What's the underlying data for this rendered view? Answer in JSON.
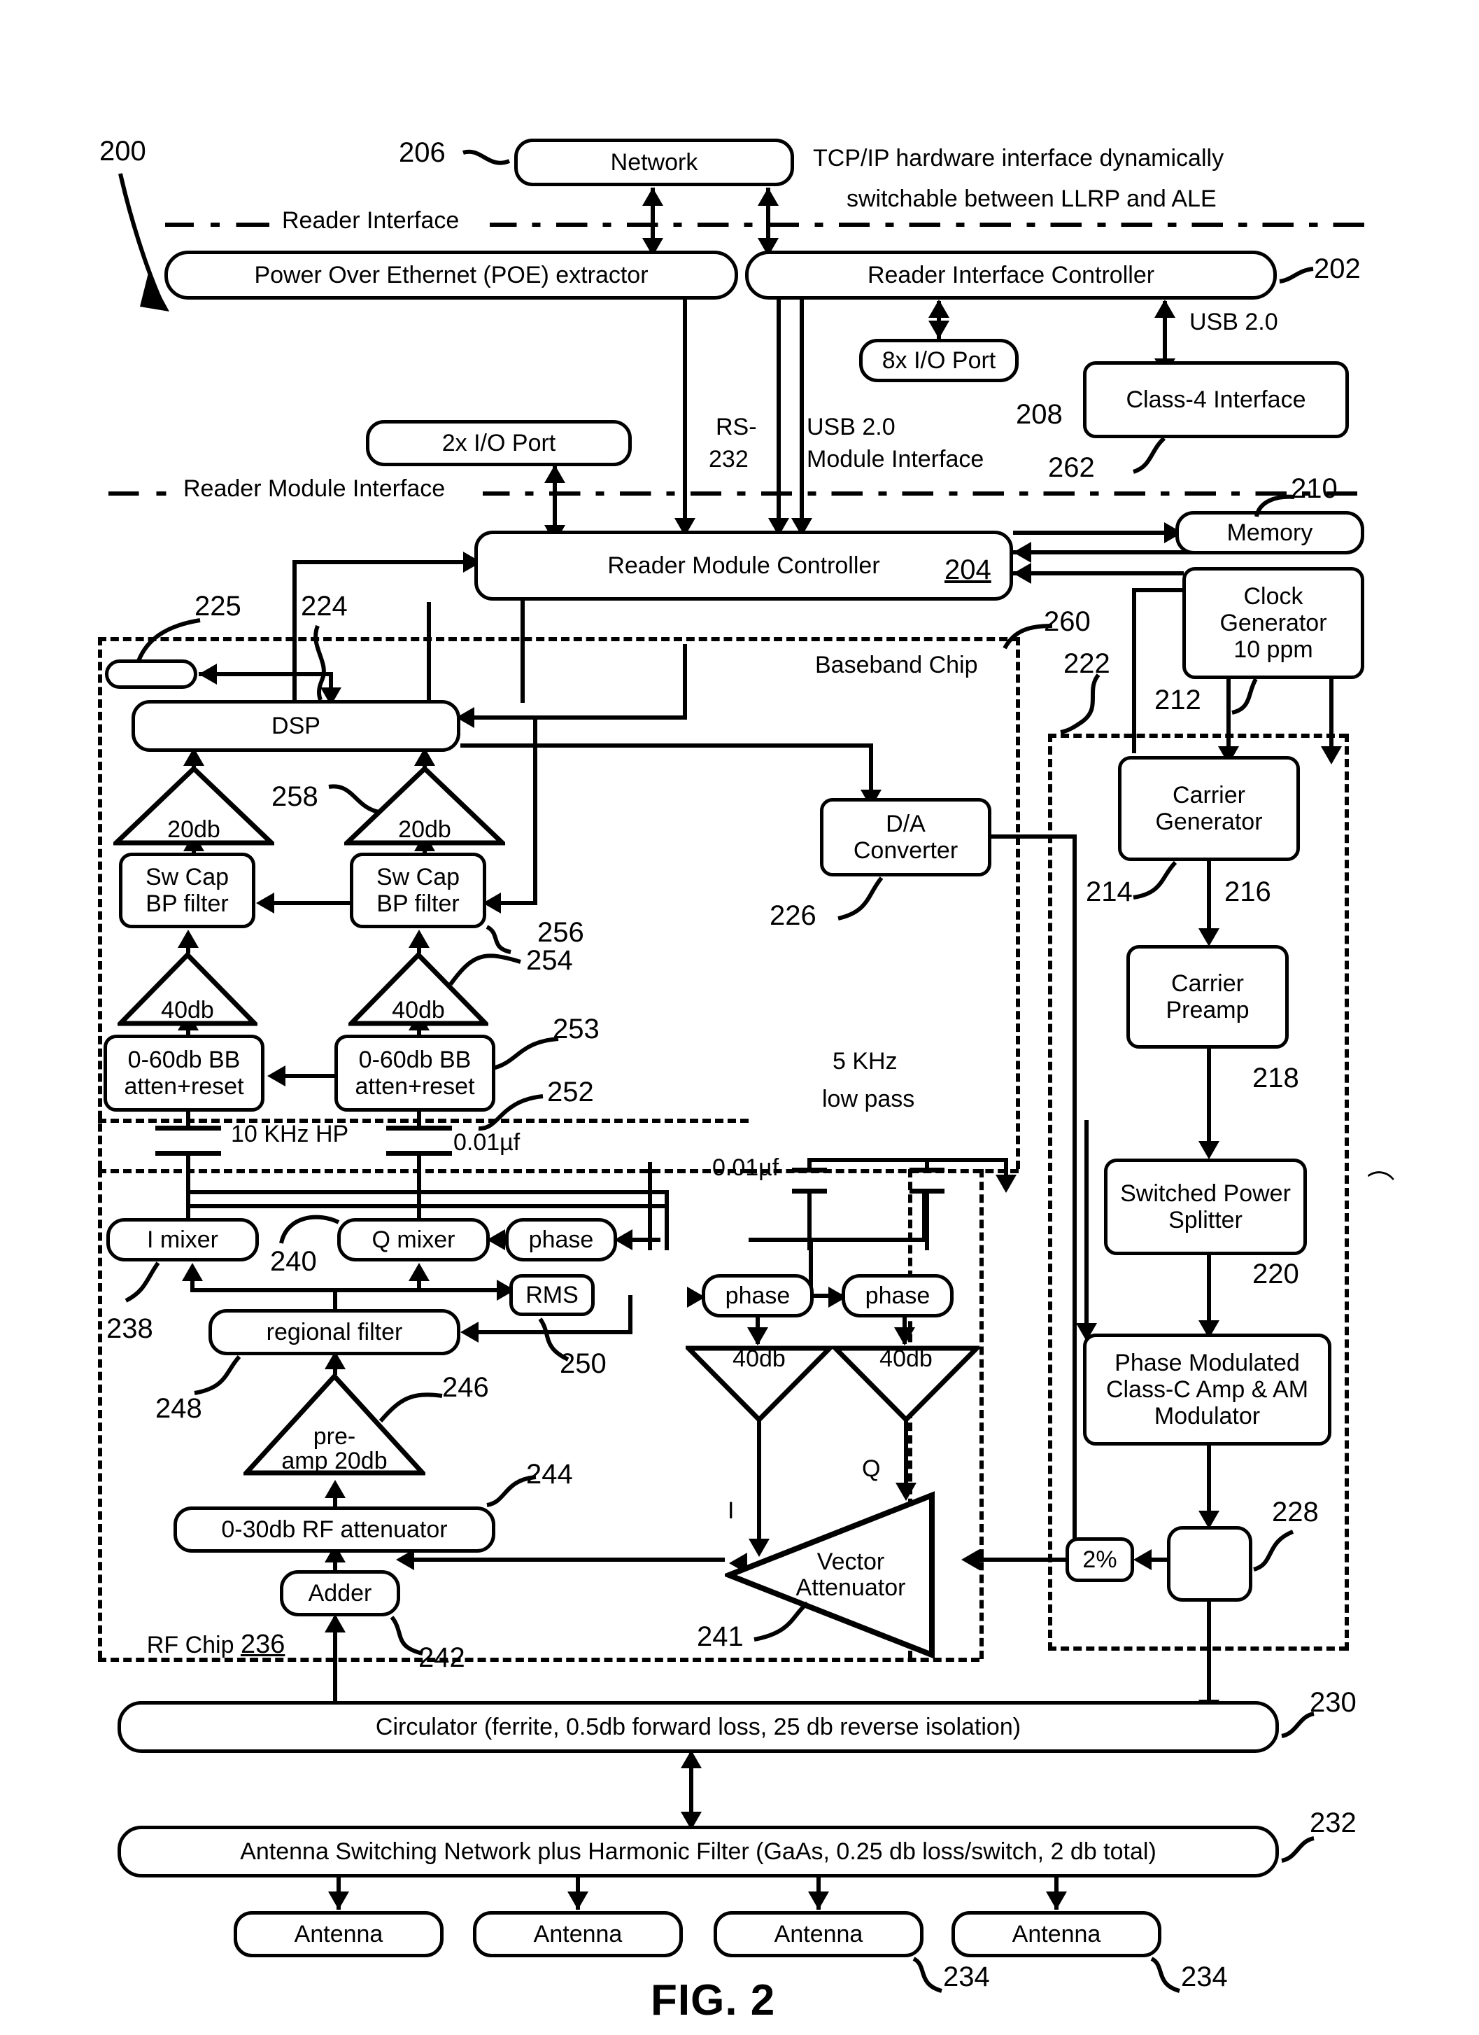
{
  "figure": {
    "caption": "FIG. 2",
    "system_ref": "200"
  },
  "interfaces": [
    {
      "label": "Reader Interface",
      "ref": ""
    },
    {
      "label": "Reader Module Interface",
      "ref": ""
    }
  ],
  "annotations": {
    "tcpip_note_line1": "TCP/IP hardware interface dynamically",
    "tcpip_note_line2": "switchable between LLRP and ALE",
    "usb_top": "USB 2.0",
    "rs232_line1": "RS-",
    "rs232_line2": "232",
    "usb_module_line1": "USB 2.0",
    "usb_module_line2": "Module Interface",
    "baseband_chip": "Baseband Chip",
    "rf_chip": "RF Chip",
    "rf_chip_ref": "236",
    "hp_filter": "10 KHz HP",
    "cap_value_left": "0.01µf",
    "cap_value_right": "0.01µf",
    "low_pass_line1": "5 KHz",
    "low_pass_line2": "low pass",
    "i_label": "I",
    "q_label": "Q"
  },
  "blocks": {
    "network": {
      "label": "Network",
      "ref": "206"
    },
    "poe": {
      "label": "Power Over Ethernet (POE) extractor",
      "ref": ""
    },
    "reader_interface_controller": {
      "label": "Reader Interface Controller",
      "ref": "202"
    },
    "io8": {
      "label": "8x I/O Port",
      "ref": "208"
    },
    "class4": {
      "label": "Class-4 Interface",
      "ref": "262"
    },
    "io2": {
      "label": "2x I/O Port",
      "ref": ""
    },
    "reader_module_controller": {
      "label": "Reader Module Controller",
      "ref": "204"
    },
    "memory": {
      "label": "Memory",
      "ref": "210"
    },
    "clock_generator": {
      "label": "Clock\nGenerator\n10 ppm",
      "ref": "212"
    },
    "small_block_225": {
      "label": "",
      "ref": "225"
    },
    "dsp": {
      "label": "DSP",
      "ref": "224"
    },
    "amp20_left": {
      "label": "20db",
      "ref": ""
    },
    "amp20_right": {
      "label": "20db",
      "ref": "258"
    },
    "swcap_left": {
      "label": "Sw Cap\nBP filter",
      "ref": ""
    },
    "swcap_right": {
      "label": "Sw Cap\nBP filter",
      "ref": "256"
    },
    "amp40_left": {
      "label": "40db",
      "ref": ""
    },
    "amp40_right": {
      "label": "40db",
      "ref": "254"
    },
    "bb_atten_left": {
      "label": "0-60db BB\natten+reset",
      "ref": ""
    },
    "bb_atten_right": {
      "label": "0-60db BB\natten+reset",
      "ref": "253"
    },
    "cap_ref": "252",
    "da_converter": {
      "label": "D/A\nConverter",
      "ref": "226"
    },
    "carrier_generator": {
      "label": "Carrier\nGenerator",
      "ref": "214"
    },
    "carrier_preamp": {
      "label": "Carrier\nPreamp",
      "ref": "216"
    },
    "switched_power_splitter": {
      "label": "Switched Power\nSplitter",
      "ref": "218"
    },
    "class_c_amp": {
      "label": "Phase Modulated\nClass-C Amp & AM\nModulator",
      "ref": "220"
    },
    "coupler": {
      "label": "",
      "ref": "228"
    },
    "two_percent": {
      "label": "2%",
      "ref": ""
    },
    "i_mixer": {
      "label": "I mixer",
      "ref": "238"
    },
    "q_mixer": {
      "label": "Q mixer",
      "ref": "240"
    },
    "phase_top": {
      "label": "phase",
      "ref": ""
    },
    "rms": {
      "label": "RMS",
      "ref": "250"
    },
    "regional_filter": {
      "label": "regional filter",
      "ref": "248"
    },
    "phase_mid_left": {
      "label": "phase",
      "ref": ""
    },
    "phase_mid_right": {
      "label": "phase",
      "ref": ""
    },
    "amp40_mid_left": {
      "label": "40db",
      "ref": ""
    },
    "amp40_mid_right": {
      "label": "40db",
      "ref": ""
    },
    "preamp": {
      "label": "pre-\namp 20db",
      "ref": "246"
    },
    "rf_attenuator": {
      "label": "0-30db RF attenuator",
      "ref": "244"
    },
    "adder": {
      "label": "Adder",
      "ref": "242"
    },
    "vector_attenuator": {
      "label": "Vector\nAttenuator",
      "ref": "241"
    },
    "circulator": {
      "label": "Circulator (ferrite, 0.5db forward loss, 25 db reverse isolation)",
      "ref": "230"
    },
    "antenna_switch": {
      "label": "Antenna Switching Network plus Harmonic Filter (GaAs, 0.25 db loss/switch, 2 db total)",
      "ref": "232"
    },
    "antennas": [
      {
        "label": "Antenna",
        "ref": ""
      },
      {
        "label": "Antenna",
        "ref": ""
      },
      {
        "label": "Antenna",
        "ref": "234"
      },
      {
        "label": "Antenna",
        "ref": "234"
      }
    ]
  },
  "chip_refs": {
    "baseband_chip_ref": "260",
    "rf_section_ref": "222"
  }
}
